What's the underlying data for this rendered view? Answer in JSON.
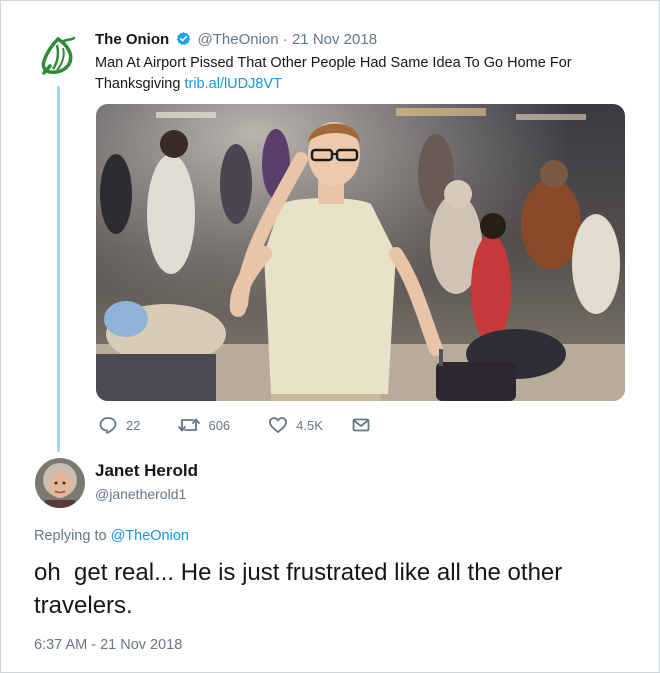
{
  "tweet": {
    "author_name": "The Onion",
    "handle": "@TheOnion",
    "separator": "·",
    "date": "21 Nov 2018",
    "text": "Man At Airport Pissed That Other People Had Same Idea To Go Home For Thanksgiving",
    "link": "trib.al/lUDJ8VT",
    "image_icon": "photo-airport-crowd",
    "actions": {
      "replies": "22",
      "retweets": "606",
      "likes": "4.5K"
    }
  },
  "reply": {
    "author_name": "Janet Herold",
    "handle": "@janetherold1",
    "replying_prefix": "Replying to",
    "replying_to": "@TheOnion",
    "text": "oh  get real... He is just frustrated like all the other travelers.",
    "timestamp": "6:37 AM - 21 Nov 2018"
  },
  "colors": {
    "link_blue": "#1b95e0",
    "muted_gray": "#657786",
    "thread_line": "#a7d1f0",
    "onion_green": "#2f8a3a"
  }
}
